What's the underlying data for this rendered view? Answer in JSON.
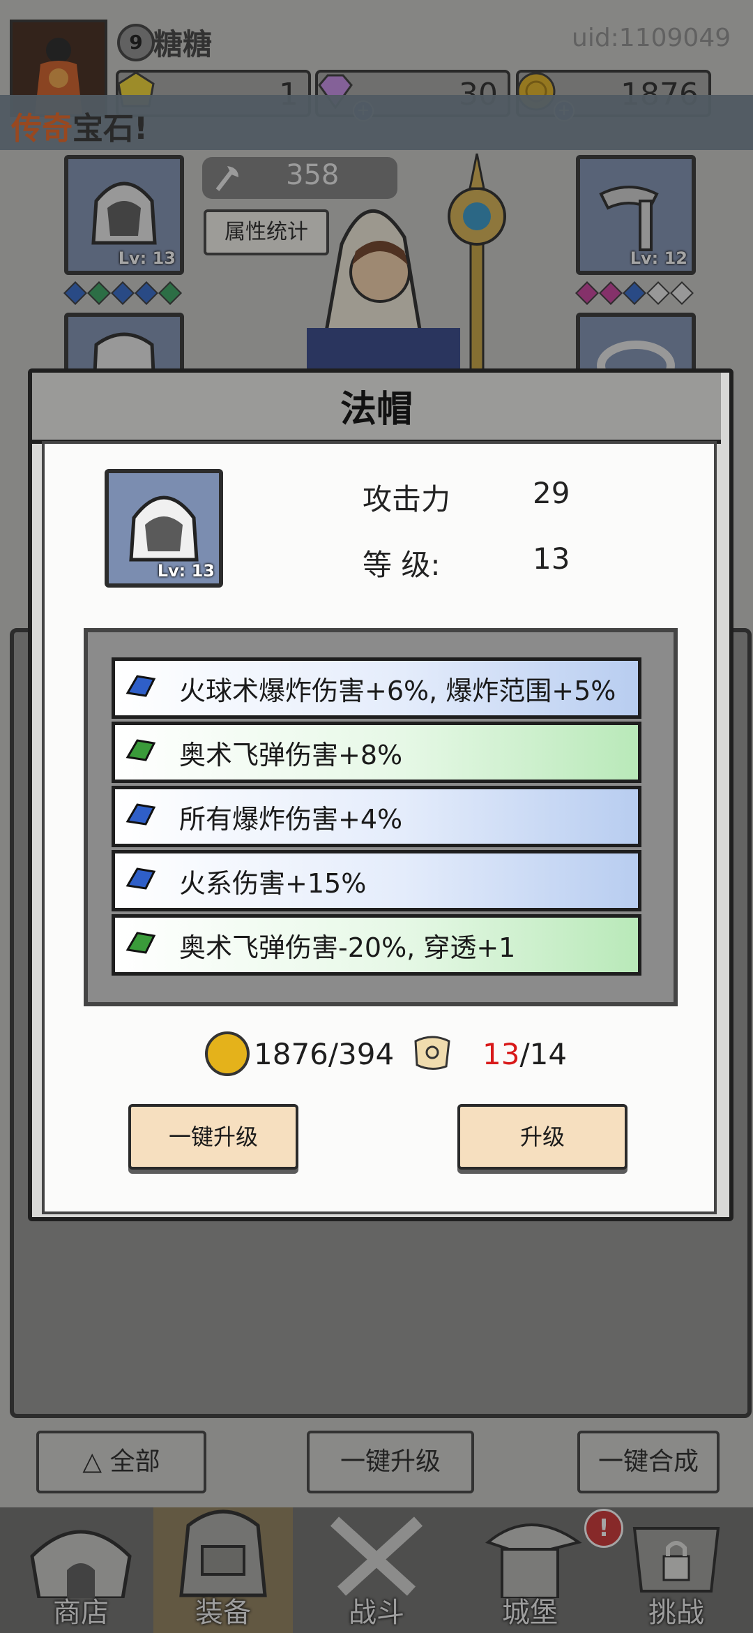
{
  "player": {
    "level": "9",
    "name": "糖糖",
    "uid": "uid:1109049"
  },
  "resources": [
    {
      "icon": "yellow-gem-icon",
      "value": "1"
    },
    {
      "icon": "purple-diamond-icon",
      "value": "30"
    },
    {
      "icon": "gold-coin-icon",
      "value": "1876"
    }
  ],
  "banner": {
    "part1": "传奇",
    "part2": "宝石!"
  },
  "equipment": {
    "power": "358",
    "stats_button": "属性统计",
    "left_slot_level": "Lv: 13",
    "right_slot_level": "Lv: 12"
  },
  "bottom_actions": {
    "filter": "全部",
    "upgrade_all": "一键升级",
    "merge_all": "一键合成"
  },
  "nav": [
    "商店",
    "装备",
    "战斗",
    "城堡",
    "挑战"
  ],
  "nav_active_index": 1,
  "nav_alert": "!",
  "modal": {
    "title": "法帽",
    "item_level": "Lv: 13",
    "attack_label": "攻击力",
    "attack_value": "29",
    "level_label": "等 级:",
    "level_value": "13",
    "affixes": [
      {
        "color": "blue",
        "text": "火球术爆炸伤害+6%, 爆炸范围+5%"
      },
      {
        "color": "green",
        "text": "奥术飞弹伤害+8%"
      },
      {
        "color": "blue",
        "text": "所有爆炸伤害+4%"
      },
      {
        "color": "blue",
        "text": "火系伤害+15%"
      },
      {
        "color": "green",
        "text": "奥术飞弹伤害-20%, 穿透+1"
      }
    ],
    "coin_cost": "1876/394",
    "scroll_have": "13",
    "scroll_need": "/14",
    "btn_upgrade_all": "一键升级",
    "btn_upgrade": "升级"
  },
  "colors": {
    "affix_blue": "#2f5fc8",
    "affix_green": "#3a9b3a",
    "insufficient": "#d81919",
    "button_fill": "#f6dfbf"
  }
}
